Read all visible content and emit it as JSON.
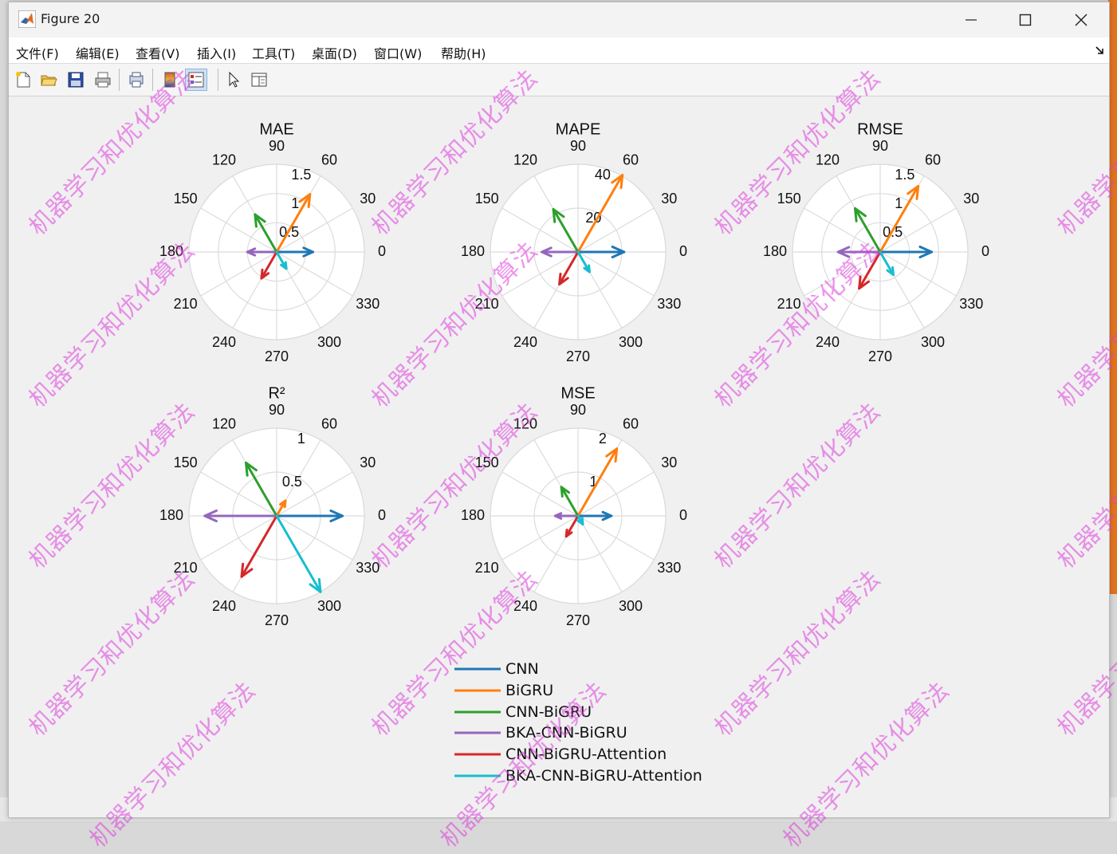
{
  "window": {
    "title": "Figure 20"
  },
  "menu": [
    "文件(F)",
    "编辑(E)",
    "查看(V)",
    "插入(I)",
    "工具(T)",
    "桌面(D)",
    "窗口(W)",
    "帮助(H)"
  ],
  "toolbar": [
    "new-figure-icon",
    "open-folder-icon",
    "save-icon",
    "print-icon",
    "print-preview-icon",
    "colorbar-icon",
    "legend-icon",
    "pointer-icon",
    "property-inspector-icon"
  ],
  "colors": {
    "CNN": "#1f77b4",
    "BiGRU": "#ff7f0e",
    "CNN-BiGRU": "#2ca02c",
    "BKA-CNN-BiGRU": "#9467bd",
    "CNN-BiGRU-Attention": "#d62728",
    "BKA-CNN-BiGRU-Attention": "#17becf"
  },
  "chart_data": [
    {
      "type": "compass",
      "title": "MAE",
      "rmax": 1.5,
      "rticks": [
        "0.5",
        "1",
        "1.5"
      ],
      "angle_ticks": [
        "0",
        "30",
        "60",
        "90",
        "120",
        "150",
        "180",
        "210",
        "240",
        "270",
        "300",
        "330"
      ],
      "series": [
        {
          "name": "CNN",
          "magnitude": 0.62,
          "angle": 0
        },
        {
          "name": "BiGRU",
          "magnitude": 1.14,
          "angle": 60
        },
        {
          "name": "CNN-BiGRU",
          "magnitude": 0.74,
          "angle": 120
        },
        {
          "name": "BKA-CNN-BiGRU",
          "magnitude": 0.5,
          "angle": 180
        },
        {
          "name": "CNN-BiGRU-Attention",
          "magnitude": 0.52,
          "angle": 240
        },
        {
          "name": "BKA-CNN-BiGRU-Attention",
          "magnitude": 0.33,
          "angle": 300
        }
      ]
    },
    {
      "type": "compass",
      "title": "MAPE",
      "rmax": 40,
      "rticks": [
        "20",
        "40"
      ],
      "angle_ticks": [
        "0",
        "30",
        "60",
        "90",
        "120",
        "150",
        "180",
        "210",
        "240",
        "270",
        "300",
        "330"
      ],
      "series": [
        {
          "name": "CNN",
          "magnitude": 21,
          "angle": 0
        },
        {
          "name": "BiGRU",
          "magnitude": 40.5,
          "angle": 60
        },
        {
          "name": "CNN-BiGRU",
          "magnitude": 22.5,
          "angle": 120
        },
        {
          "name": "BKA-CNN-BiGRU",
          "magnitude": 16.5,
          "angle": 180
        },
        {
          "name": "CNN-BiGRU-Attention",
          "magnitude": 17,
          "angle": 240
        },
        {
          "name": "BKA-CNN-BiGRU-Attention",
          "magnitude": 10.5,
          "angle": 300
        }
      ]
    },
    {
      "type": "compass",
      "title": "RMSE",
      "rmax": 1.5,
      "rticks": [
        "0.5",
        "1",
        "1.5"
      ],
      "angle_ticks": [
        "0",
        "30",
        "60",
        "90",
        "120",
        "150",
        "180",
        "210",
        "240",
        "270",
        "300",
        "330"
      ],
      "series": [
        {
          "name": "CNN",
          "magnitude": 0.88,
          "angle": 0
        },
        {
          "name": "BiGRU",
          "magnitude": 1.3,
          "angle": 60
        },
        {
          "name": "CNN-BiGRU",
          "magnitude": 0.86,
          "angle": 120
        },
        {
          "name": "BKA-CNN-BiGRU",
          "magnitude": 0.72,
          "angle": 180
        },
        {
          "name": "CNN-BiGRU-Attention",
          "magnitude": 0.72,
          "angle": 240
        },
        {
          "name": "BKA-CNN-BiGRU-Attention",
          "magnitude": 0.45,
          "angle": 300
        }
      ]
    },
    {
      "type": "compass",
      "title": "R²",
      "rmax": 1,
      "rticks": [
        "0.5",
        "1"
      ],
      "angle_ticks": [
        "0",
        "30",
        "60",
        "90",
        "120",
        "150",
        "180",
        "210",
        "240",
        "270",
        "300",
        "330"
      ],
      "series": [
        {
          "name": "CNN",
          "magnitude": 0.75,
          "angle": 0
        },
        {
          "name": "BiGRU",
          "magnitude": 0.2,
          "angle": 60
        },
        {
          "name": "CNN-BiGRU",
          "magnitude": 0.7,
          "angle": 120
        },
        {
          "name": "BKA-CNN-BiGRU",
          "magnitude": 0.82,
          "angle": 180
        },
        {
          "name": "CNN-BiGRU-Attention",
          "magnitude": 0.8,
          "angle": 240
        },
        {
          "name": "BKA-CNN-BiGRU-Attention",
          "magnitude": 1.0,
          "angle": 300
        }
      ]
    },
    {
      "type": "compass",
      "title": "MSE",
      "rmax": 2,
      "rticks": [
        "1",
        "2"
      ],
      "angle_ticks": [
        "0",
        "30",
        "60",
        "90",
        "120",
        "150",
        "180",
        "210",
        "240",
        "270",
        "300",
        "330"
      ],
      "series": [
        {
          "name": "CNN",
          "magnitude": 0.76,
          "angle": 0
        },
        {
          "name": "BiGRU",
          "magnitude": 1.77,
          "angle": 60
        },
        {
          "name": "CNN-BiGRU",
          "magnitude": 0.76,
          "angle": 120
        },
        {
          "name": "BKA-CNN-BiGRU",
          "magnitude": 0.52,
          "angle": 180
        },
        {
          "name": "CNN-BiGRU-Attention",
          "magnitude": 0.54,
          "angle": 240
        },
        {
          "name": "BKA-CNN-BiGRU-Attention",
          "magnitude": 0.22,
          "angle": 300
        }
      ]
    }
  ],
  "legend": [
    "CNN",
    "BiGRU",
    "CNN-BiGRU",
    "BKA-CNN-BiGRU",
    "CNN-BiGRU-Attention",
    "BKA-CNN-BiGRU-Attention"
  ],
  "watermark": "机器学习和优化算法"
}
